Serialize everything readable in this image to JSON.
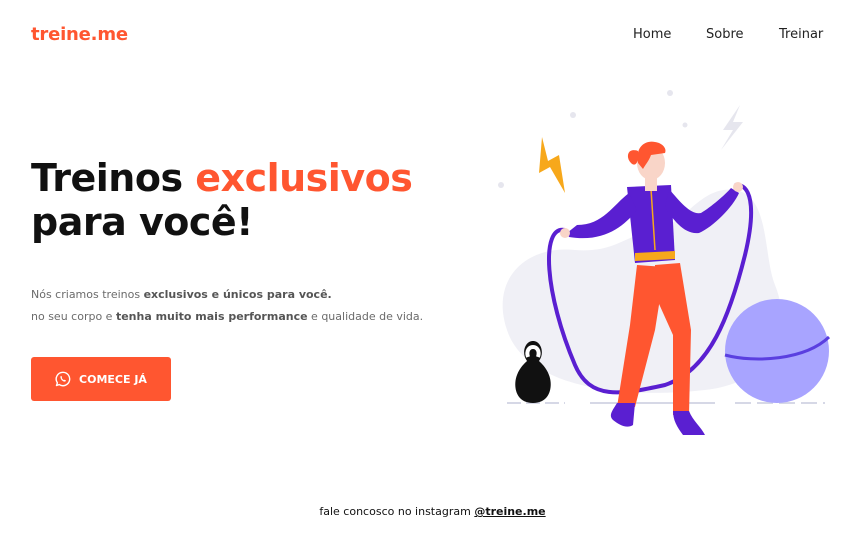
{
  "header": {
    "logo": "treine.me",
    "nav": [
      {
        "label": "Home"
      },
      {
        "label": "Sobre"
      },
      {
        "label": "Treinar"
      }
    ]
  },
  "hero": {
    "title_line1_start": "Treinos ",
    "title_line1_accent": "exclusivos",
    "title_line2": "para você!",
    "desc_line1_part1": "Nós criamos treinos ",
    "desc_line1_bold": "exclusivos e únicos para você.",
    "desc_line2_part1": "no seu corpo e ",
    "desc_line2_bold": "tenha muito mais performance",
    "desc_line2_part2": " e qualidade de vida.",
    "cta_label": "COMECE JÁ",
    "cta_icon": "whatsapp-icon"
  },
  "footer": {
    "text": "fale concosco no instagram ",
    "link": "@treine.me"
  },
  "colors": {
    "accent": "#ff5630",
    "purple": "#5a1fd1",
    "ball": "#a8a4ff",
    "bolt": "#f7a81b"
  }
}
